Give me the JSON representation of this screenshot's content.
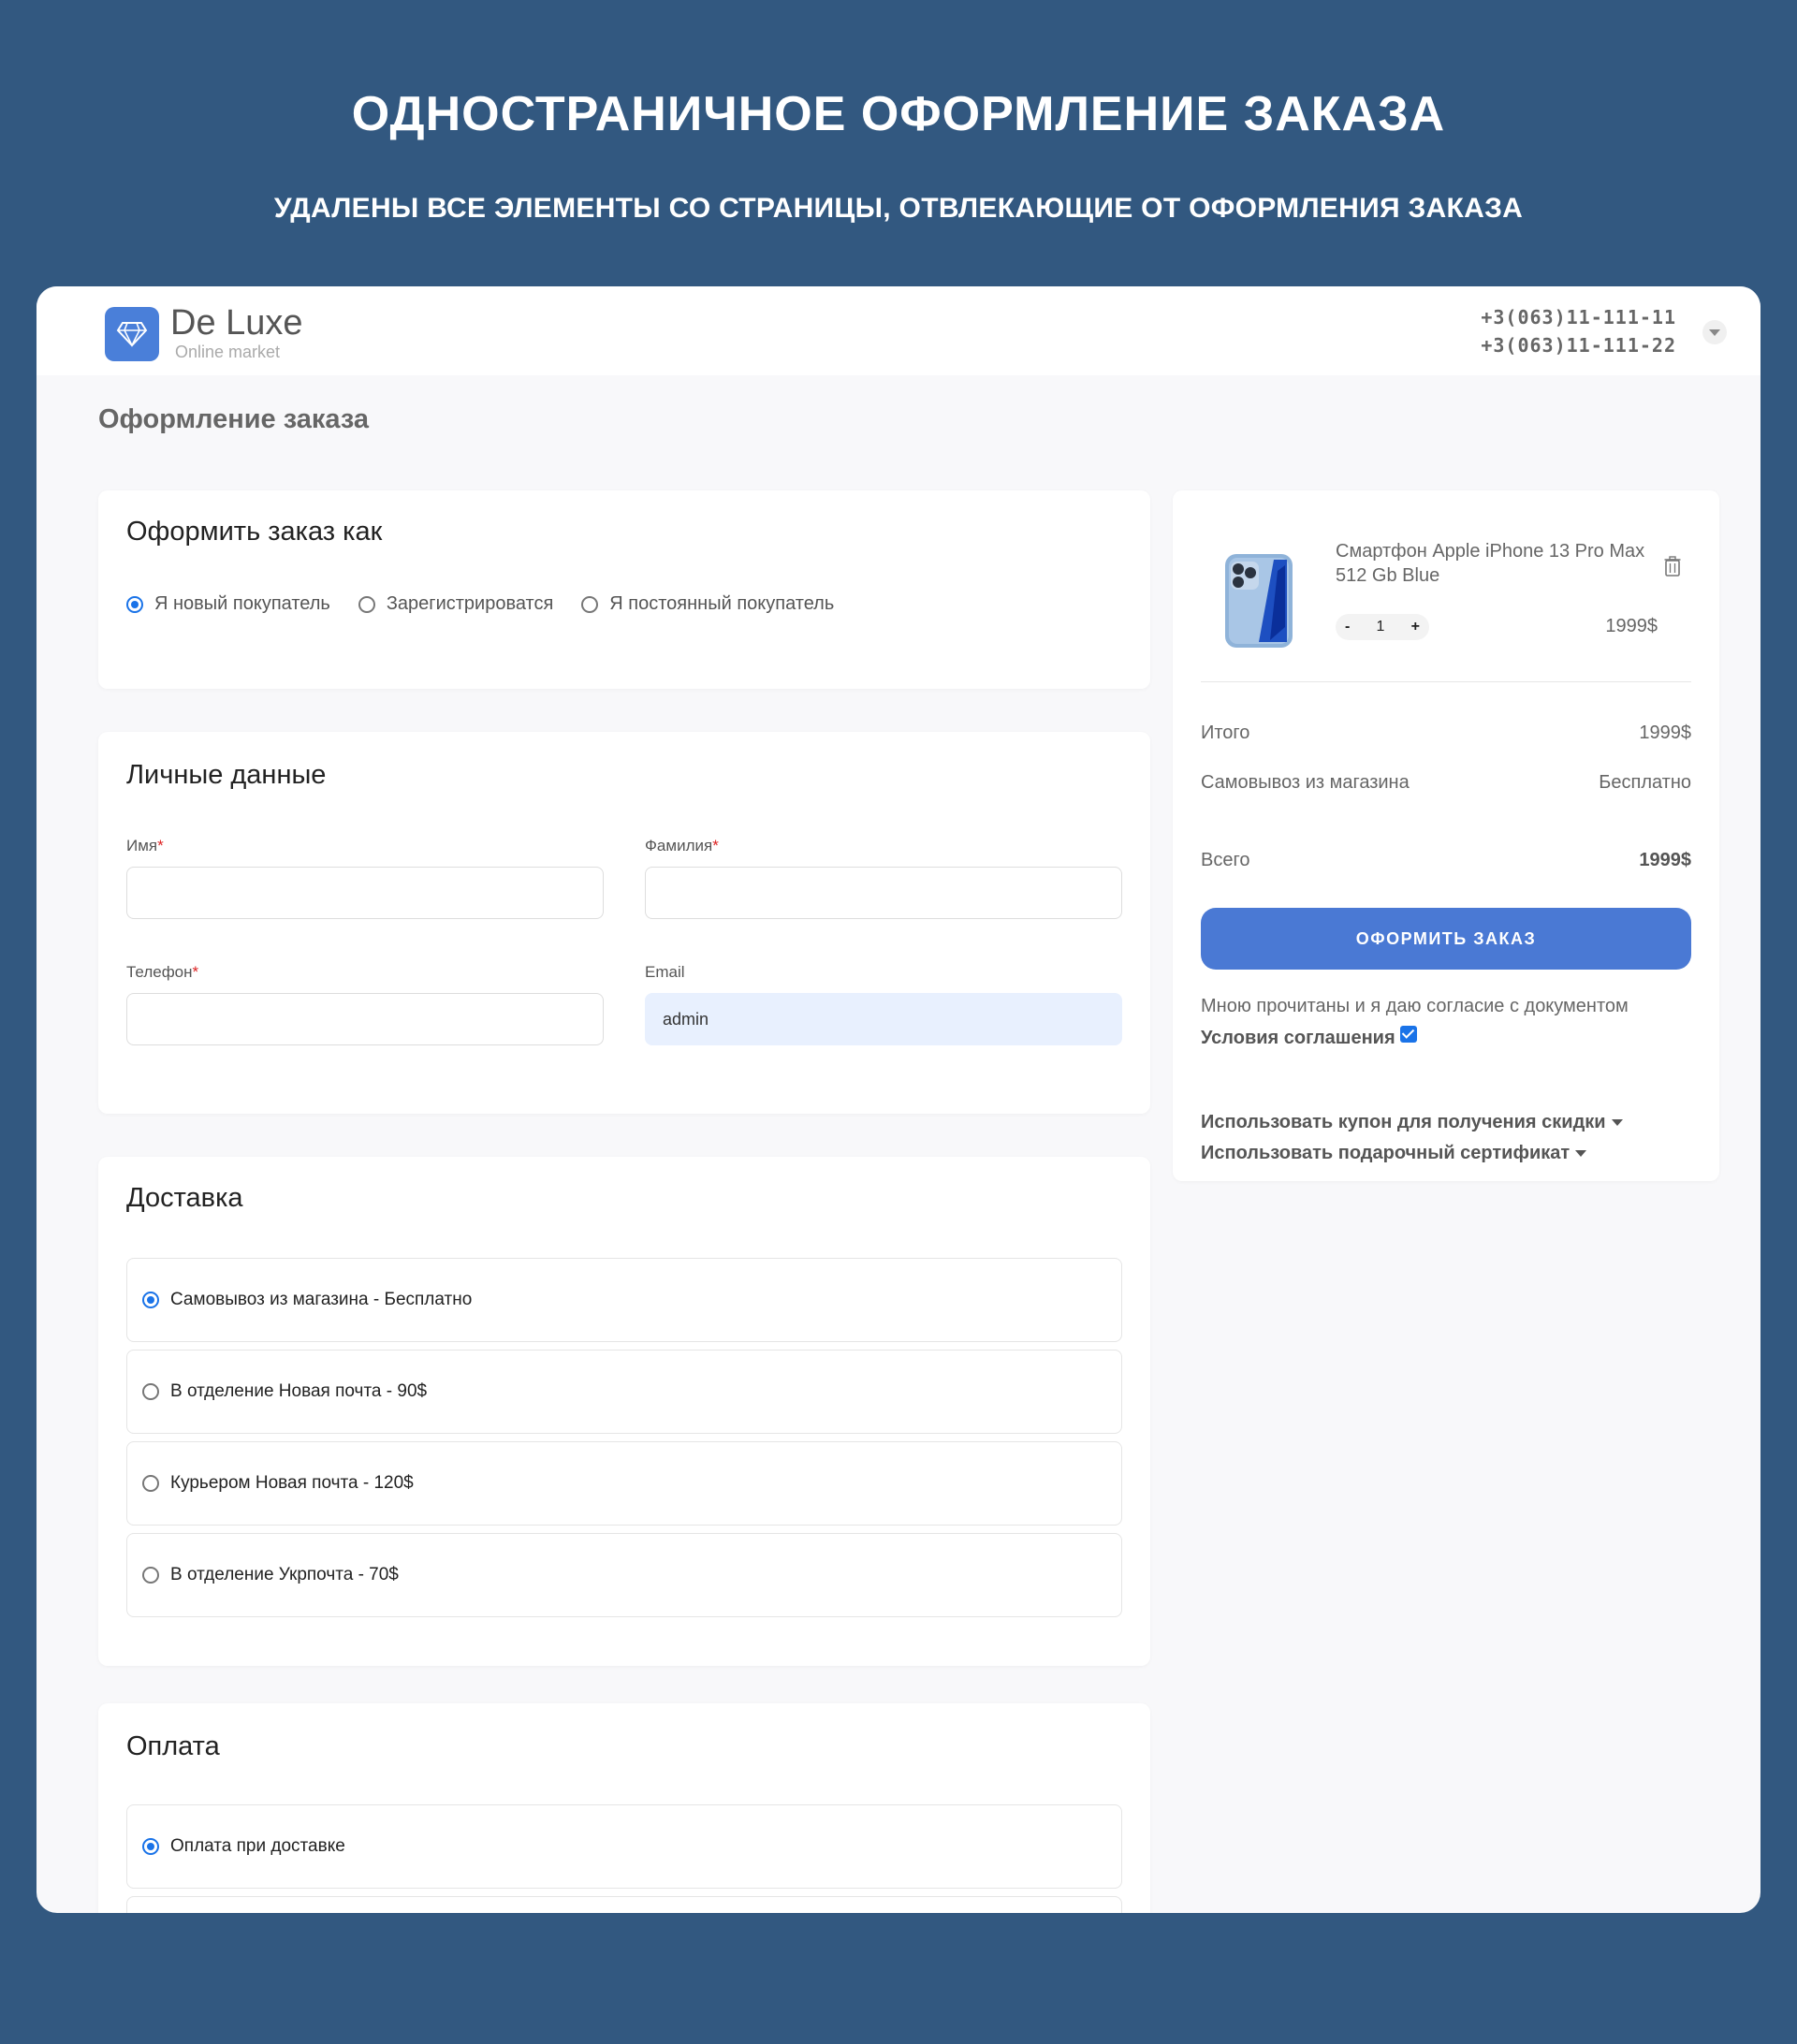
{
  "promo": {
    "title": "ОДНОСТРАНИЧНОЕ ОФОРМЛЕНИЕ ЗАКАЗА",
    "subtitle": "УДАЛЕНЫ ВСЕ ЭЛЕМЕНТЫ СО СТРАНИЦЫ, ОТВЛЕКАЮЩИЕ ОТ ОФОРМЛЕНИЯ ЗАКАЗА"
  },
  "header": {
    "logo_name": "De Luxe",
    "logo_tagline": "Online market",
    "logo_icon": "diamond-icon",
    "phones": [
      "+3(063)11-111-11",
      "+3(063)11-111-22"
    ]
  },
  "page_title": "Оформление заказа",
  "order_as": {
    "title": "Оформить заказ как",
    "options": [
      {
        "label": "Я новый покупатель",
        "selected": true
      },
      {
        "label": "Зарегистрироватся",
        "selected": false
      },
      {
        "label": "Я постоянный покупатель",
        "selected": false
      }
    ]
  },
  "personal": {
    "title": "Личные данные",
    "first_name_label": "Имя",
    "last_name_label": "Фамилия",
    "phone_label": "Телефон",
    "email_label": "Email",
    "required_mark": "*",
    "first_name_value": "",
    "last_name_value": "",
    "phone_value": "",
    "email_value": "admin"
  },
  "delivery": {
    "title": "Доставка",
    "options": [
      {
        "label": "Самовывоз из магазина - Бесплатно",
        "selected": true
      },
      {
        "label": "В отделение Новая почта - 90$",
        "selected": false
      },
      {
        "label": "Курьером Новая почта - 120$",
        "selected": false
      },
      {
        "label": "В отделение Укрпочта - 70$",
        "selected": false
      }
    ]
  },
  "payment": {
    "title": "Оплата",
    "options": [
      {
        "label": "Оплата при доставке",
        "selected": true
      }
    ]
  },
  "cart": {
    "product_name": "Смартфон Apple iPhone 13 Pro Max 512 Gb Blue",
    "qty": "1",
    "minus": "-",
    "plus": "+",
    "price": "1999$",
    "subtotal_label": "Итого",
    "subtotal_value": "1999$",
    "shipping_label": "Самовывоз из магазина",
    "shipping_value": "Бесплатно",
    "total_label": "Всего",
    "total_value": "1999$",
    "order_button": "ОФОРМИТЬ ЗАКАЗ",
    "agree_text": "Мною прочитаны и я даю согласие с документом",
    "terms_link": "Условия соглашения",
    "agree_checked": true,
    "coupon_link": "Использовать купон для получения скидки",
    "gift_link": "Использовать подарочный сертификат"
  },
  "colors": {
    "page_bg": "#325880",
    "accent": "#4a79d4",
    "radio_active": "#1a73e8",
    "required": "#dd2222"
  }
}
